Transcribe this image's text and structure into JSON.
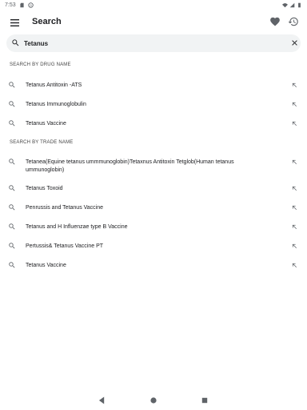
{
  "status_bar": {
    "time": "7:53"
  },
  "app_bar": {
    "title": "Search"
  },
  "search": {
    "query": "Tetanus",
    "placeholder": ""
  },
  "sections": [
    {
      "header": "SEARCH BY DRUG NAME",
      "items": [
        {
          "label": "Tetanus Antitoxin -ATS"
        },
        {
          "label": "Tetanus Immunoglobulin"
        },
        {
          "label": "Tetanus Vaccine"
        }
      ]
    },
    {
      "header": "SEARCH BY TRADE NAME",
      "items": [
        {
          "label": "Tetanea(Equine tetanus ummmunoglobin)Tetaxnus Antitoxin Tetglob(Human tetanus ummunoglobin)"
        },
        {
          "label": "Tetanus Toxoid"
        },
        {
          "label": "Penrussis and Tetanus Vaccine"
        },
        {
          "label": "Tetanus and H Influenzae type B Vaccine"
        },
        {
          "label": "Pertussis& Tetanus Vaccine PT"
        },
        {
          "label": "Tetanus Vaccine"
        }
      ]
    }
  ],
  "icons": {
    "menu": "menu-icon",
    "favorite": "heart-icon",
    "history": "history-icon",
    "search": "search-icon",
    "clear": "close-icon",
    "fill_query": "arrow-up-left-icon"
  },
  "colors": {
    "icon": "#5f6368",
    "search_bg": "#f1f3f4",
    "text": "#202124"
  }
}
